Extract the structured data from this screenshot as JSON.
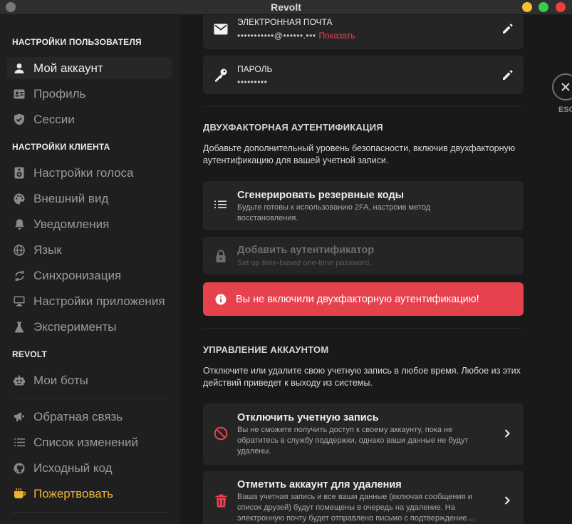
{
  "window": {
    "title": "Revolt"
  },
  "sidebar": {
    "user_section": "НАСТРОЙКИ ПОЛЬЗОВАТЕЛЯ",
    "user_items": [
      {
        "label": "Мой аккаунт",
        "icon": "person-icon"
      },
      {
        "label": "Профиль",
        "icon": "id-card-icon"
      },
      {
        "label": "Сессии",
        "icon": "shield-check-icon"
      }
    ],
    "client_section": "НАСТРОЙКИ КЛИЕНТА",
    "client_items": [
      {
        "label": "Настройки голоса",
        "icon": "speaker-icon"
      },
      {
        "label": "Внешний вид",
        "icon": "palette-icon"
      },
      {
        "label": "Уведомления",
        "icon": "bell-icon"
      },
      {
        "label": "Язык",
        "icon": "globe-icon"
      },
      {
        "label": "Синхронизация",
        "icon": "sync-icon"
      },
      {
        "label": "Настройки приложения",
        "icon": "monitor-icon"
      },
      {
        "label": "Эксперименты",
        "icon": "flask-icon"
      }
    ],
    "revolt_section": "REVOLT",
    "revolt_items": [
      {
        "label": "Мои боты",
        "icon": "robot-icon"
      }
    ],
    "misc_items": [
      {
        "label": "Обратная связь",
        "icon": "megaphone-icon"
      },
      {
        "label": "Список изменений",
        "icon": "list-icon"
      },
      {
        "label": "Исходный код",
        "icon": "github-icon"
      },
      {
        "label": "Пожертвовать",
        "icon": "coffee-icon"
      }
    ]
  },
  "account": {
    "email_label": "ЭЛЕКТРОННАЯ ПОЧТА",
    "email_value": "•••••••••••@••••••.•••",
    "email_show": "Показать",
    "password_label": "ПАРОЛЬ",
    "password_value": "•••••••••"
  },
  "two_factor": {
    "heading": "ДВУХФАКТОРНАЯ АУТЕНТИФИКАЦИЯ",
    "description": "Добавьте дополнительный уровень безопасности, включив двухфакторную аутентификацию для вашей учетной записи.",
    "backup_title": "Сгенерировать резервные коды",
    "backup_sub": "Будьте готовы к использованию 2FA, настроив метод восстановления.",
    "auth_title": "Добавить аутентификатор",
    "auth_sub": "Set up time-based one-time password.",
    "alert": "Вы не включили двухфакторную аутентификацию!"
  },
  "management": {
    "heading": "УПРАВЛЕНИЕ АККАУНТОМ",
    "description": "Отключите или удалите свою учетную запись в любое время. Любое из этих действий приведет к выходу из системы.",
    "disable_title": "Отключить учетную запись",
    "disable_sub": "Вы не сможете получить доступ к своему аккаунту, пока не обратитесь в службу поддержки, однако ваши данные не будут удалены.",
    "delete_title": "Отметить аккаунт для удаления",
    "delete_sub": "Ваша учетная запись и все ваши данные (включая сообщения и список друзей) будут помещены в очередь на удаление. На электронную почту будет отправлено письмо с подтверждение…"
  },
  "close": {
    "label": "ESC"
  },
  "colors": {
    "accent": "#e9414f",
    "donate": "#f0b232",
    "sidebar_bg": "#1f1f1f",
    "content_bg": "#191919",
    "card_bg": "#252525"
  }
}
